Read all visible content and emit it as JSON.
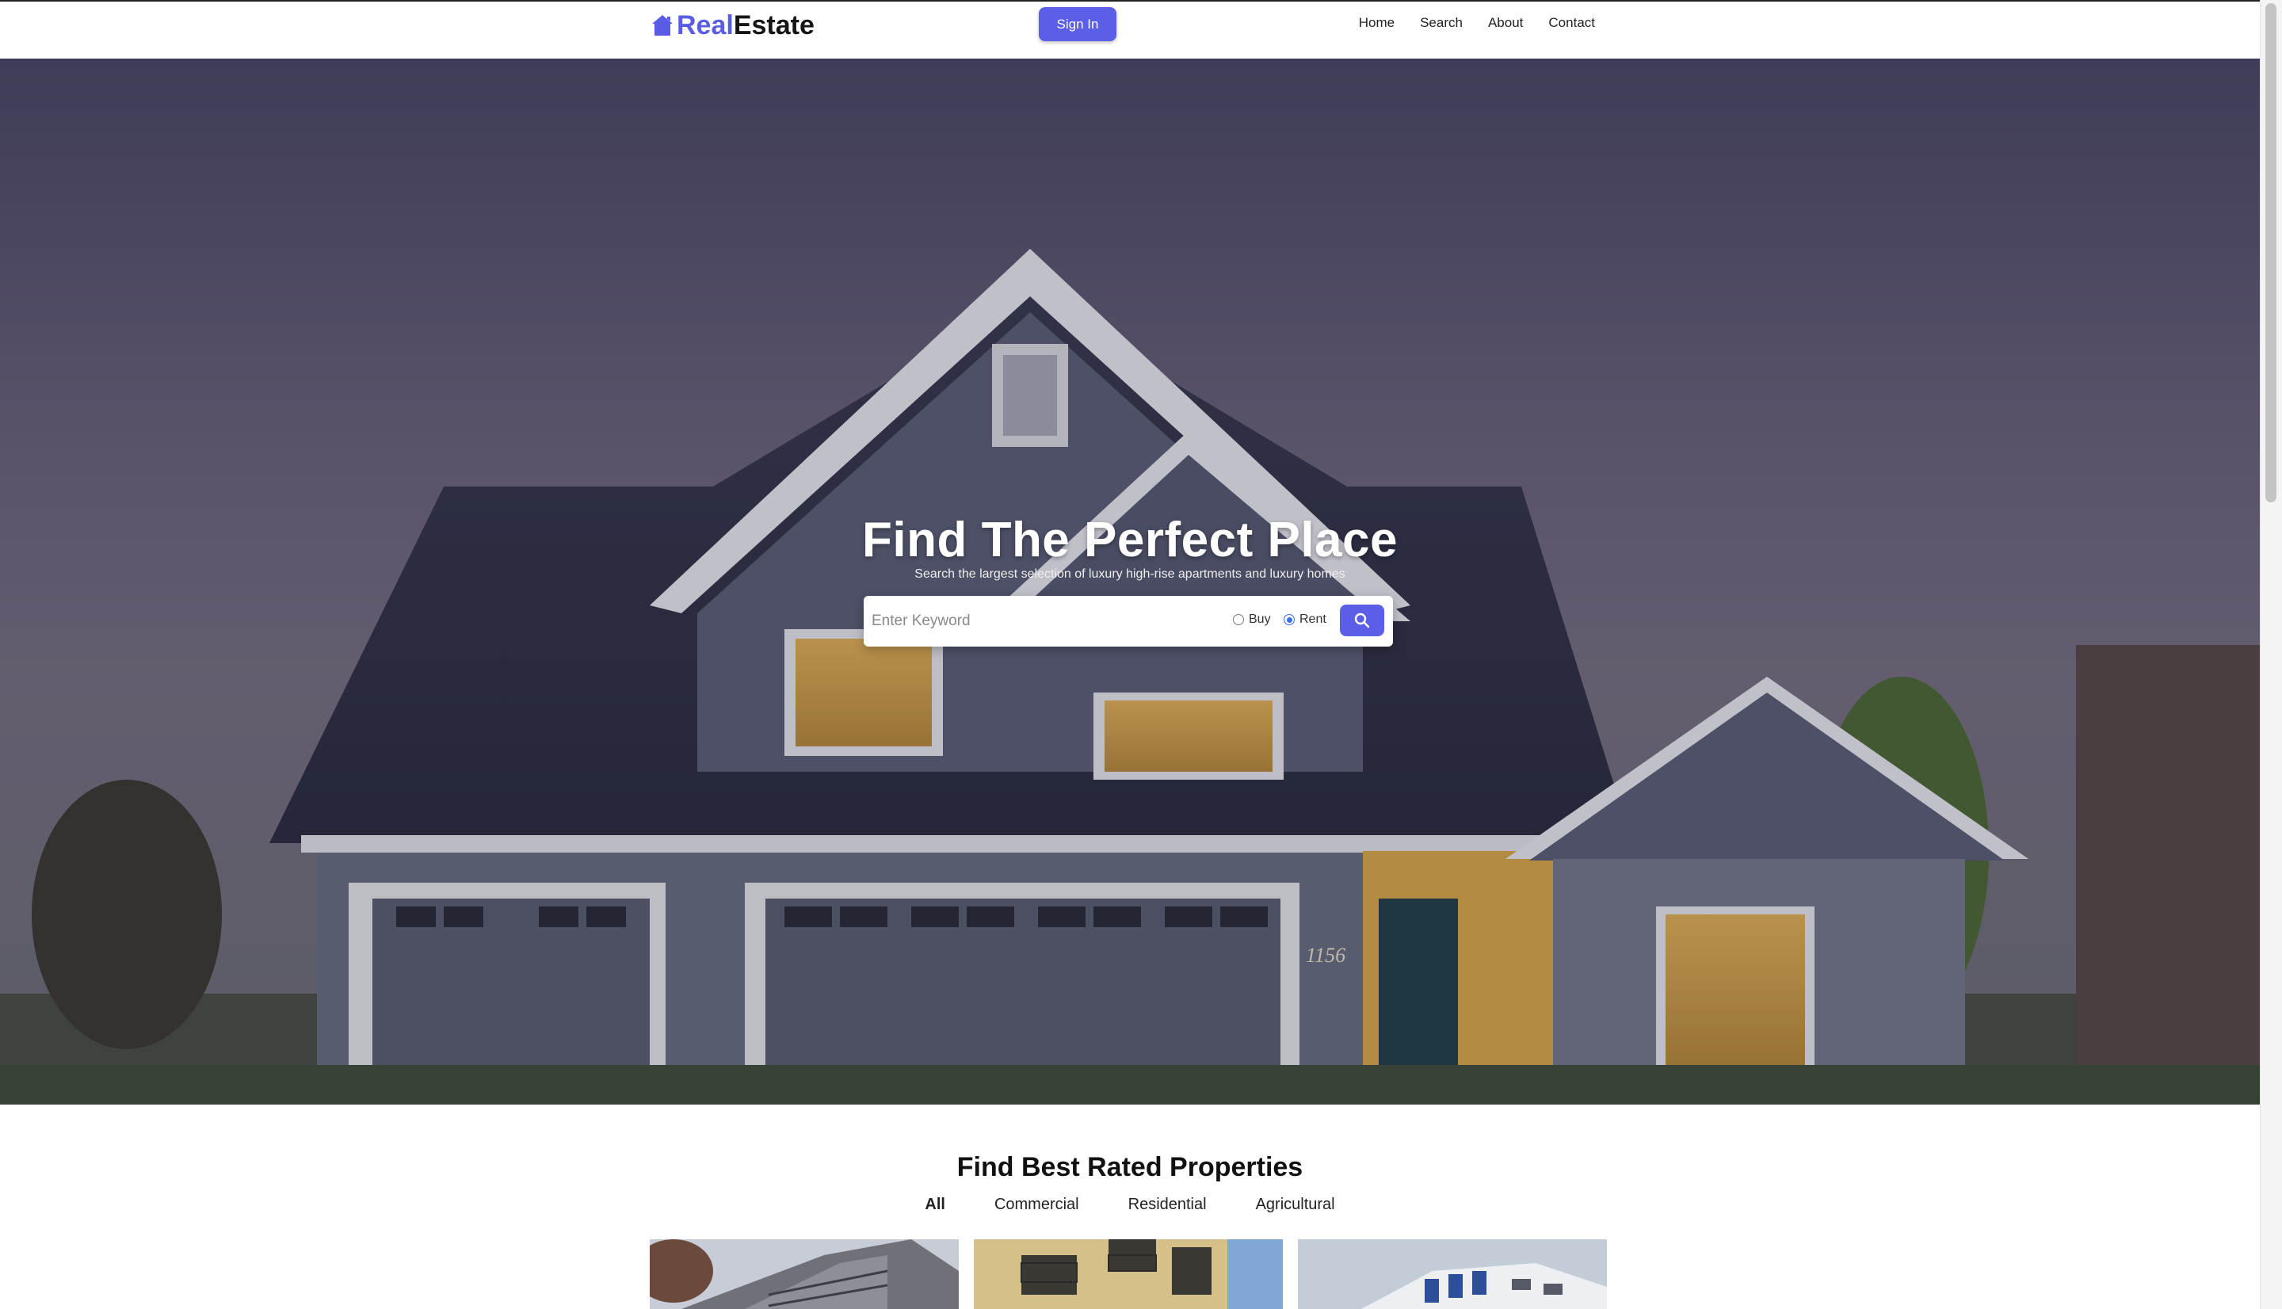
{
  "brand": {
    "name_part1": "Real",
    "name_part2": "Estate",
    "icon": "house-icon",
    "color": "#5a5ce6"
  },
  "header": {
    "signin_label": "Sign In",
    "nav": [
      "Home",
      "Search",
      "About",
      "Contact"
    ]
  },
  "hero": {
    "title": "Find The Perfect Place",
    "subtitle": "Search the largest selection of luxury high-rise apartments and luxury homes",
    "house_number": "1156",
    "search": {
      "placeholder": "Enter Keyword",
      "options": [
        {
          "label": "Buy",
          "selected": false
        },
        {
          "label": "Rent",
          "selected": true
        }
      ],
      "button_icon": "search-icon"
    }
  },
  "properties": {
    "title": "Find Best Rated Properties",
    "filters": [
      {
        "label": "All",
        "active": true
      },
      {
        "label": "Commercial",
        "active": false
      },
      {
        "label": "Residential",
        "active": false
      },
      {
        "label": "Agricultural",
        "active": false
      }
    ]
  },
  "colors": {
    "accent": "#5b5fe8",
    "text": "#111111",
    "background": "#ffffff"
  }
}
